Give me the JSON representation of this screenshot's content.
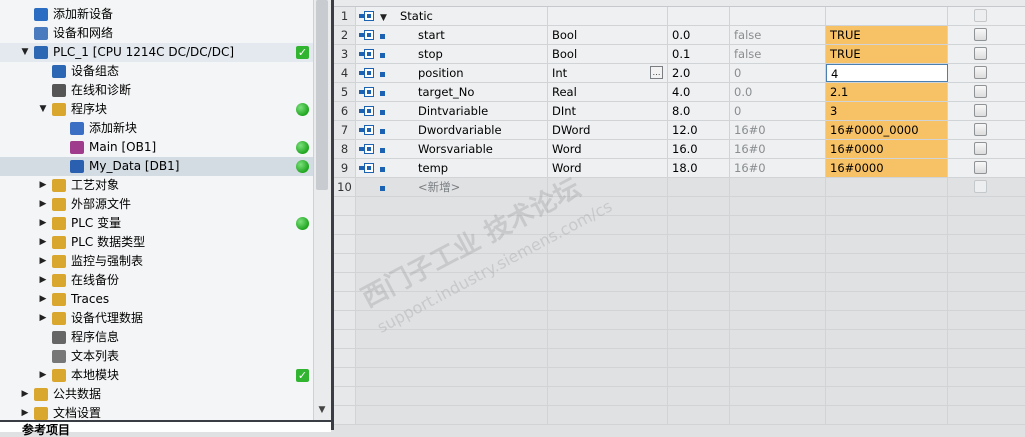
{
  "tree": {
    "items": [
      {
        "label": "添加新设备",
        "icon": "add-device-icon",
        "arrow": "",
        "status": ""
      },
      {
        "label": "设备和网络",
        "icon": "network-icon",
        "arrow": "",
        "status": ""
      },
      {
        "label": "PLC_1 [CPU 1214C DC/DC/DC]",
        "icon": "plc-icon",
        "arrow": "▼",
        "status": "check"
      },
      {
        "label": "设备组态",
        "icon": "device-config-icon",
        "arrow": "",
        "status": ""
      },
      {
        "label": "在线和诊断",
        "icon": "online-diagnostics-icon",
        "arrow": "",
        "status": ""
      },
      {
        "label": "程序块",
        "icon": "folder-icon",
        "arrow": "▼",
        "status": "green"
      },
      {
        "label": "添加新块",
        "icon": "add-block-icon",
        "arrow": "",
        "status": ""
      },
      {
        "label": "Main [OB1]",
        "icon": "ob-block-icon",
        "arrow": "",
        "status": "green"
      },
      {
        "label": "My_Data [DB1]",
        "icon": "db-block-icon",
        "arrow": "",
        "status": "green"
      },
      {
        "label": "工艺对象",
        "icon": "folder-icon",
        "arrow": "▶",
        "status": ""
      },
      {
        "label": "外部源文件",
        "icon": "folder-icon",
        "arrow": "▶",
        "status": ""
      },
      {
        "label": "PLC 变量",
        "icon": "folder-icon",
        "arrow": "▶",
        "status": "green"
      },
      {
        "label": "PLC 数据类型",
        "icon": "folder-icon",
        "arrow": "▶",
        "status": ""
      },
      {
        "label": "监控与强制表",
        "icon": "folder-icon",
        "arrow": "▶",
        "status": ""
      },
      {
        "label": "在线备份",
        "icon": "folder-icon",
        "arrow": "▶",
        "status": ""
      },
      {
        "label": "Traces",
        "icon": "folder-icon",
        "arrow": "▶",
        "status": ""
      },
      {
        "label": "设备代理数据",
        "icon": "folder-icon",
        "arrow": "▶",
        "status": ""
      },
      {
        "label": "程序信息",
        "icon": "program-info-icon",
        "arrow": "",
        "status": ""
      },
      {
        "label": "文本列表",
        "icon": "text-list-icon",
        "arrow": "",
        "status": ""
      },
      {
        "label": "本地模块",
        "icon": "folder-icon",
        "arrow": "▶",
        "status": "check"
      },
      {
        "label": "公共数据",
        "icon": "folder-icon",
        "arrow": "▶",
        "status": ""
      },
      {
        "label": "文档设置",
        "icon": "folder-icon",
        "arrow": "▶",
        "status": ""
      }
    ],
    "bottom_label": "参考项目",
    "scroll_down": "▼"
  },
  "table": {
    "rows": [
      {
        "num": "1",
        "name": "Static",
        "type": "",
        "offset": "",
        "start": "",
        "monitor": "",
        "kind": "group"
      },
      {
        "num": "2",
        "name": "start",
        "type": "Bool",
        "offset": "0.0",
        "start": "false",
        "monitor": "TRUE",
        "kind": "orange"
      },
      {
        "num": "3",
        "name": "stop",
        "type": "Bool",
        "offset": "0.1",
        "start": "false",
        "monitor": "TRUE",
        "kind": "orange"
      },
      {
        "num": "4",
        "name": "position",
        "type": "Int",
        "offset": "2.0",
        "start": "0",
        "monitor": "4",
        "kind": "focus"
      },
      {
        "num": "5",
        "name": "target_No",
        "type": "Real",
        "offset": "4.0",
        "start": "0.0",
        "monitor": "2.1",
        "kind": "orange"
      },
      {
        "num": "6",
        "name": "Dintvariable",
        "type": "DInt",
        "offset": "8.0",
        "start": "0",
        "monitor": "3",
        "kind": "orange"
      },
      {
        "num": "7",
        "name": "Dwordvariable",
        "type": "DWord",
        "offset": "12.0",
        "start": "16#0",
        "monitor": "16#0000_0000",
        "kind": "orange"
      },
      {
        "num": "8",
        "name": "Worsvariable",
        "type": "Word",
        "offset": "16.0",
        "start": "16#0",
        "monitor": "16#0000",
        "kind": "orange"
      },
      {
        "num": "9",
        "name": "temp",
        "type": "Word",
        "offset": "18.0",
        "start": "16#0",
        "monitor": "16#0000",
        "kind": "orange"
      },
      {
        "num": "10",
        "name": "<新增>",
        "type": "",
        "offset": "",
        "start": "",
        "monitor": "",
        "kind": "new"
      }
    ],
    "empty_row_count": 12,
    "ellipsis_glyph": "…"
  },
  "watermark": {
    "line1": "西门子工业 技术论坛",
    "line2": "support.industry.siemens.com/cs"
  }
}
